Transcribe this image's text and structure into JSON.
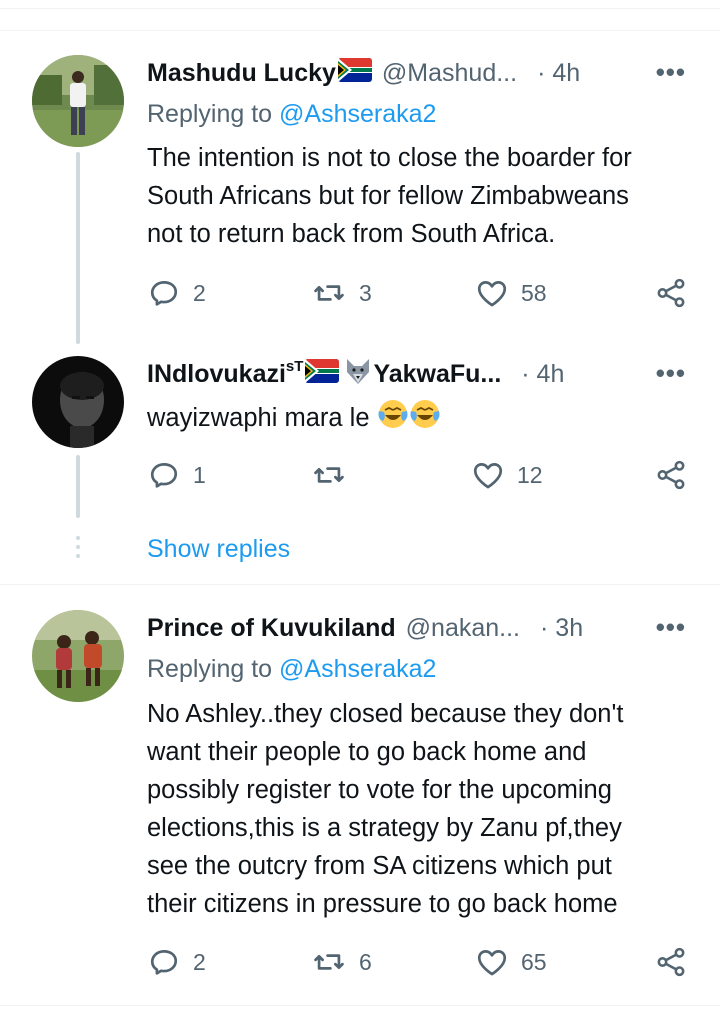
{
  "tweets": [
    {
      "name": "Mashudu Lucky",
      "handle": "@Mashud...",
      "time": "· 4h",
      "replying_prefix": "Replying to ",
      "replying_to": "@Ashseraka2",
      "text_lines": [
        "The intention is not to close the boarder for",
        "South Africans but for fellow Zimbabweans",
        "not to return back from South Africa."
      ],
      "replies": "2",
      "retweets": "3",
      "likes": "58"
    },
    {
      "name": "INdlovukazi",
      "name_sup": "sT",
      "name_suffix": "YakwaFu...",
      "time": "· 4h",
      "text": "wayizwaphi mara le",
      "replies": "1",
      "retweets": "",
      "likes": "12"
    },
    {
      "name": "Prince of Kuvukiland",
      "handle": "@nakan...",
      "time": "· 3h",
      "replying_prefix": "Replying to ",
      "replying_to": "@Ashseraka2",
      "text_lines": [
        "No Ashley..they closed because they don't",
        "want their people to go back home and",
        "possibly register to vote for the upcoming",
        "elections,this is a strategy by Zanu pf,they",
        "see the outcry from SA citizens which put",
        "their citizens in pressure to go back home"
      ],
      "replies": "2",
      "retweets": "6",
      "likes": "65"
    }
  ],
  "show_replies": "Show replies",
  "more_glyph": "•••",
  "icons": [
    "reply-icon",
    "retweet-icon",
    "like-icon",
    "share-icon",
    "south-africa-flag-icon",
    "wolf-icon",
    "tears-of-joy-emoji"
  ],
  "colors": {
    "accent": "#1d9bf0",
    "secondary_text": "#536471",
    "thread_line": "#cfd9de"
  }
}
